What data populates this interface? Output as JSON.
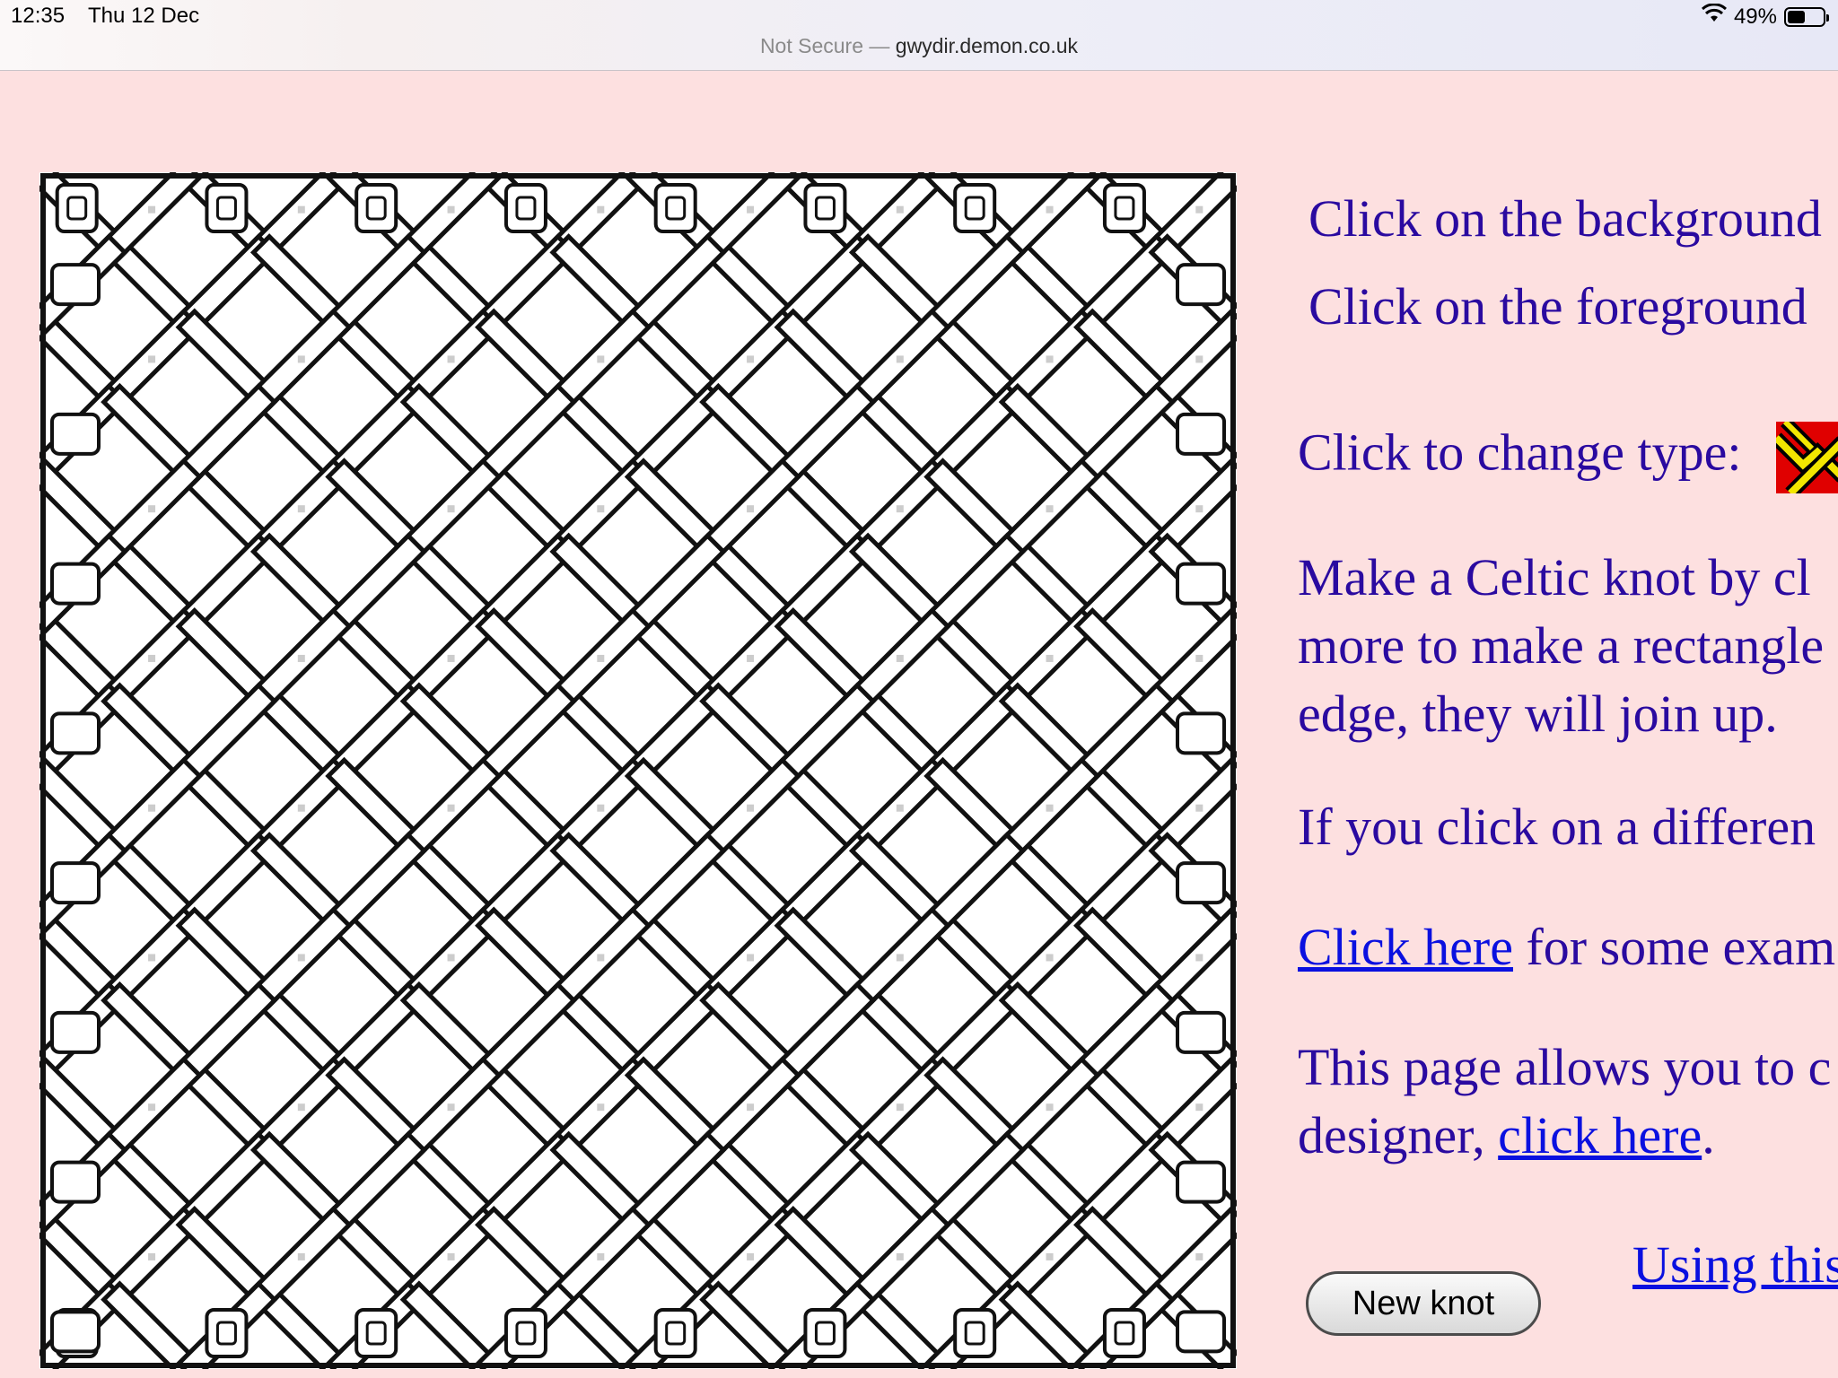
{
  "status_bar": {
    "time": "12:35",
    "date": "Thu 12 Dec",
    "battery_percent": "49%",
    "battery_level": 0.49
  },
  "address_bar": {
    "security": "Not Secure",
    "separator": " — ",
    "host": "gwydir.demon.co.uk"
  },
  "knot": {
    "columns": 8,
    "rows": 8
  },
  "instructions": {
    "background_click": "Click on the background",
    "foreground_click": "Click on the foreground",
    "change_type_label": "Click to change type:",
    "make_knot_line1": "Make a Celtic knot by cl",
    "make_knot_line2": "more to make a rectangle",
    "make_knot_line3": "edge, they will join up.",
    "different_click": "If you click on a differen",
    "examples_link": "Click here",
    "examples_rest": " for some exam",
    "allows_line1": "This page allows you to c",
    "allows_line2_text": "designer, ",
    "allows_line2_link": "click here",
    "allows_line2_end": "."
  },
  "buttons": {
    "new_knot": "New knot",
    "using_link": "Using this"
  },
  "type_icon": {
    "name": "knot-type-icon",
    "colors": [
      "#e00000",
      "#f2e600",
      "#000000"
    ]
  }
}
